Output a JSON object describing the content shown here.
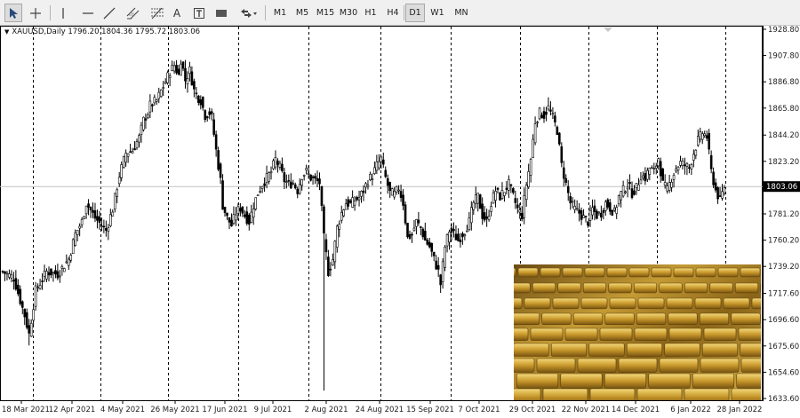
{
  "toolbar": {
    "tools": [
      {
        "name": "cursor-icon",
        "active": true
      },
      {
        "name": "crosshair-icon",
        "active": false
      },
      {
        "name": "vertical-line-icon",
        "active": false
      },
      {
        "name": "horizontal-line-icon",
        "active": false
      },
      {
        "name": "trendline-icon",
        "active": false
      },
      {
        "name": "equidistant-channel-icon",
        "active": false
      },
      {
        "name": "fibonacci-retracement-icon",
        "active": false
      },
      {
        "name": "text-tool-icon",
        "active": false
      },
      {
        "name": "text-label-icon",
        "active": false
      },
      {
        "name": "rectangle-shape-icon",
        "active": false
      },
      {
        "name": "arrows-icon",
        "active": false
      }
    ],
    "text_tool_glyph": "A",
    "timeframes": [
      "M1",
      "M5",
      "M15",
      "M30",
      "H1",
      "H4",
      "D1",
      "W1",
      "MN"
    ],
    "active_timeframe": "D1"
  },
  "chart": {
    "symbol_info": "XAUUSD,Daily  1796.20 1804.36 1795.72 1803.06",
    "current_price": "1803.06",
    "price_label_color": "#000000",
    "bull_color": "#ffffff",
    "bear_color": "#000000",
    "grid_separator_style": "dashed"
  },
  "chart_data": {
    "type": "candlestick",
    "symbol": "XAUUSD",
    "timeframe": "Daily",
    "ohlc_last": {
      "open": 1796.2,
      "high": 1804.36,
      "low": 1795.72,
      "close": 1803.06
    },
    "y_ticks": [
      "1928.80",
      "1907.80",
      "1886.80",
      "1865.80",
      "1844.20",
      "1823.20",
      "1803.06",
      "1781.20",
      "1760.20",
      "1739.20",
      "1717.60",
      "1696.60",
      "1675.60",
      "1654.60",
      "1633.60"
    ],
    "y_range": [
      1633.6,
      1928.8
    ],
    "x_ticks": [
      "18 Mar 2021",
      "12 Apr 2021",
      "4 May 2021",
      "26 May 2021",
      "17 Jun 2021",
      "9 Jul 2021",
      "2 Aug 2021",
      "24 Aug 2021",
      "15 Sep 2021",
      "7 Oct 2021",
      "29 Oct 2021",
      "22 Nov 2021",
      "14 Dec 2021",
      "6 Jan 2022",
      "28 Jan 2022"
    ],
    "period_separators": [
      "12 Apr 2021",
      "4 May 2021",
      "26 May 2021",
      "17 Jun 2021",
      "9 Jul 2021",
      "2 Aug 2021",
      "24 Aug 2021",
      "15 Sep 2021",
      "7 Oct 2021",
      "29 Oct 2021",
      "22 Nov 2021",
      "14 Dec 2021",
      "6 Jan 2022",
      "28 Jan 2022"
    ],
    "close_path": [
      [
        0,
        1735
      ],
      [
        5,
        1730
      ],
      [
        10,
        1700
      ],
      [
        12,
        1685
      ],
      [
        15,
        1720
      ],
      [
        20,
        1735
      ],
      [
        25,
        1733
      ],
      [
        30,
        1745
      ],
      [
        33,
        1765
      ],
      [
        36,
        1775
      ],
      [
        38,
        1790
      ],
      [
        42,
        1778
      ],
      [
        45,
        1772
      ],
      [
        47,
        1768
      ],
      [
        50,
        1785
      ],
      [
        53,
        1812
      ],
      [
        56,
        1830
      ],
      [
        59,
        1832
      ],
      [
        62,
        1842
      ],
      [
        64,
        1856
      ],
      [
        66,
        1862
      ],
      [
        67,
        1868
      ],
      [
        70,
        1872
      ],
      [
        74,
        1887
      ],
      [
        76,
        1895
      ],
      [
        78,
        1900
      ],
      [
        80,
        1892
      ],
      [
        81,
        1905
      ],
      [
        83,
        1888
      ],
      [
        85,
        1896
      ],
      [
        87,
        1880
      ],
      [
        89,
        1874
      ],
      [
        90,
        1872
      ],
      [
        92,
        1860
      ],
      [
        94,
        1862
      ],
      [
        95,
        1858
      ],
      [
        97,
        1832
      ],
      [
        99,
        1808
      ],
      [
        100,
        1788
      ],
      [
        102,
        1778
      ],
      [
        104,
        1772
      ],
      [
        106,
        1782
      ],
      [
        108,
        1786
      ],
      [
        110,
        1780
      ],
      [
        112,
        1775
      ],
      [
        114,
        1788
      ],
      [
        116,
        1798
      ],
      [
        118,
        1805
      ],
      [
        120,
        1810
      ],
      [
        122,
        1815
      ],
      [
        124,
        1825
      ],
      [
        126,
        1818
      ],
      [
        128,
        1808
      ],
      [
        130,
        1805
      ],
      [
        132,
        1806
      ],
      [
        134,
        1800
      ],
      [
        136,
        1812
      ],
      [
        138,
        1815
      ],
      [
        140,
        1810
      ],
      [
        142,
        1808
      ],
      [
        144,
        1806
      ],
      [
        146,
        1762
      ],
      [
        148,
        1735
      ],
      [
        150,
        1745
      ],
      [
        152,
        1770
      ],
      [
        154,
        1782
      ],
      [
        156,
        1790
      ],
      [
        158,
        1789
      ],
      [
        160,
        1792
      ],
      [
        162,
        1794
      ],
      [
        164,
        1800
      ],
      [
        166,
        1808
      ],
      [
        168,
        1812
      ],
      [
        170,
        1820
      ],
      [
        172,
        1825
      ],
      [
        174,
        1810
      ],
      [
        176,
        1798
      ],
      [
        178,
        1797
      ],
      [
        180,
        1802
      ],
      [
        182,
        1790
      ],
      [
        184,
        1762
      ],
      [
        186,
        1765
      ],
      [
        188,
        1775
      ],
      [
        190,
        1770
      ],
      [
        192,
        1760
      ],
      [
        194,
        1755
      ],
      [
        196,
        1745
      ],
      [
        198,
        1735
      ],
      [
        199,
        1725
      ],
      [
        201,
        1755
      ],
      [
        203,
        1768
      ],
      [
        205,
        1765
      ],
      [
        207,
        1760
      ],
      [
        210,
        1768
      ],
      [
        212,
        1775
      ],
      [
        214,
        1790
      ],
      [
        216,
        1795
      ],
      [
        218,
        1780
      ],
      [
        220,
        1775
      ],
      [
        222,
        1790
      ],
      [
        224,
        1800
      ],
      [
        226,
        1795
      ],
      [
        228,
        1800
      ],
      [
        230,
        1805
      ],
      [
        232,
        1795
      ],
      [
        234,
        1785
      ],
      [
        236,
        1780
      ],
      [
        238,
        1805
      ],
      [
        240,
        1825
      ],
      [
        242,
        1855
      ],
      [
        244,
        1862
      ],
      [
        246,
        1860
      ],
      [
        248,
        1866
      ],
      [
        250,
        1858
      ],
      [
        252,
        1848
      ],
      [
        254,
        1820
      ],
      [
        256,
        1805
      ],
      [
        258,
        1790
      ],
      [
        260,
        1785
      ],
      [
        262,
        1782
      ],
      [
        264,
        1778
      ],
      [
        266,
        1775
      ],
      [
        268,
        1785
      ],
      [
        270,
        1780
      ],
      [
        272,
        1782
      ],
      [
        274,
        1790
      ],
      [
        276,
        1786
      ],
      [
        278,
        1782
      ],
      [
        280,
        1795
      ],
      [
        282,
        1800
      ],
      [
        284,
        1805
      ],
      [
        286,
        1798
      ],
      [
        288,
        1802
      ],
      [
        290,
        1812
      ],
      [
        292,
        1810
      ],
      [
        294,
        1818
      ],
      [
        296,
        1815
      ],
      [
        298,
        1826
      ],
      [
        300,
        1805
      ],
      [
        302,
        1800
      ],
      [
        304,
        1810
      ],
      [
        306,
        1818
      ],
      [
        308,
        1822
      ],
      [
        310,
        1820
      ],
      [
        312,
        1818
      ],
      [
        314,
        1830
      ],
      [
        316,
        1840
      ],
      [
        318,
        1846
      ],
      [
        320,
        1843
      ],
      [
        322,
        1815
      ],
      [
        324,
        1800
      ],
      [
        326,
        1792
      ],
      [
        328,
        1803
      ]
    ]
  }
}
